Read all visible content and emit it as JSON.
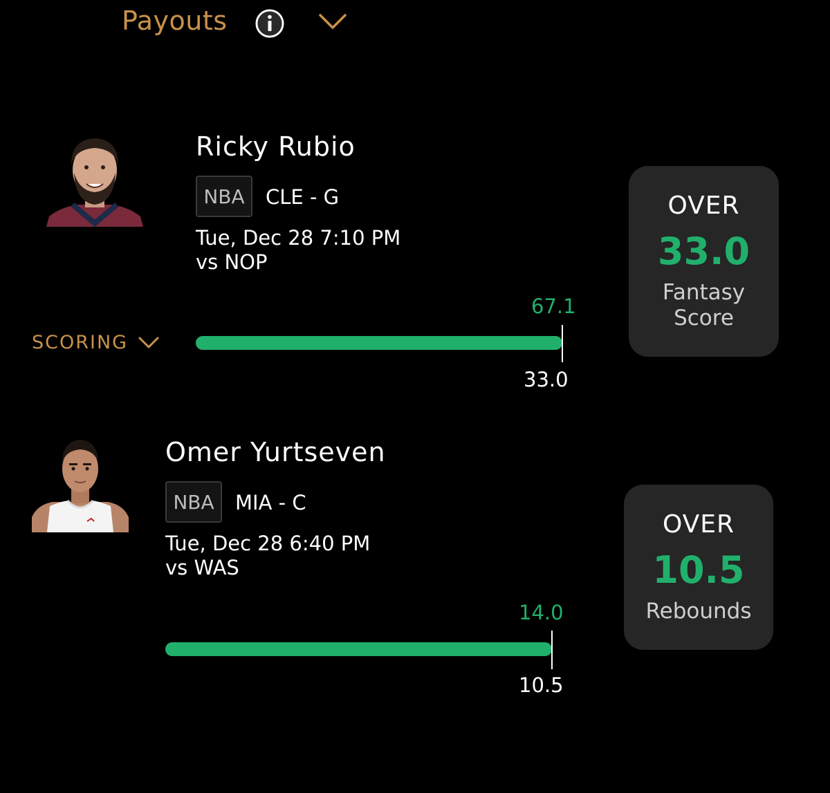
{
  "header": {
    "payouts_label": "Payouts",
    "info_icon": "info-circle-icon",
    "chevron_icon": "chevron-down-icon",
    "accent_color": "#c9924a"
  },
  "scoring_toggle": {
    "label": "SCORING",
    "icon": "chevron-down-icon"
  },
  "picks": [
    {
      "player_name": "Ricky Rubio",
      "league": "NBA",
      "team_position": "CLE - G",
      "game_time": "Tue, Dec 28 7:10 PM",
      "opponent": "vs NOP",
      "actual_value": "67.1",
      "line_value": "33.0",
      "progress_fraction": 1.0,
      "card": {
        "direction": "OVER",
        "line": "33.0",
        "stat": "Fantasy Score"
      }
    },
    {
      "player_name": "Omer Yurtseven",
      "league": "NBA",
      "team_position": "MIA - C",
      "game_time": "Tue, Dec 28 6:40 PM",
      "opponent": "vs WAS",
      "actual_value": "14.0",
      "line_value": "10.5",
      "progress_fraction": 1.0,
      "card": {
        "direction": "OVER",
        "line": "10.5",
        "stat": "Rebounds"
      }
    }
  ],
  "colors": {
    "background": "#000000",
    "progress_green": "#21b06c",
    "card_background": "#262626"
  }
}
